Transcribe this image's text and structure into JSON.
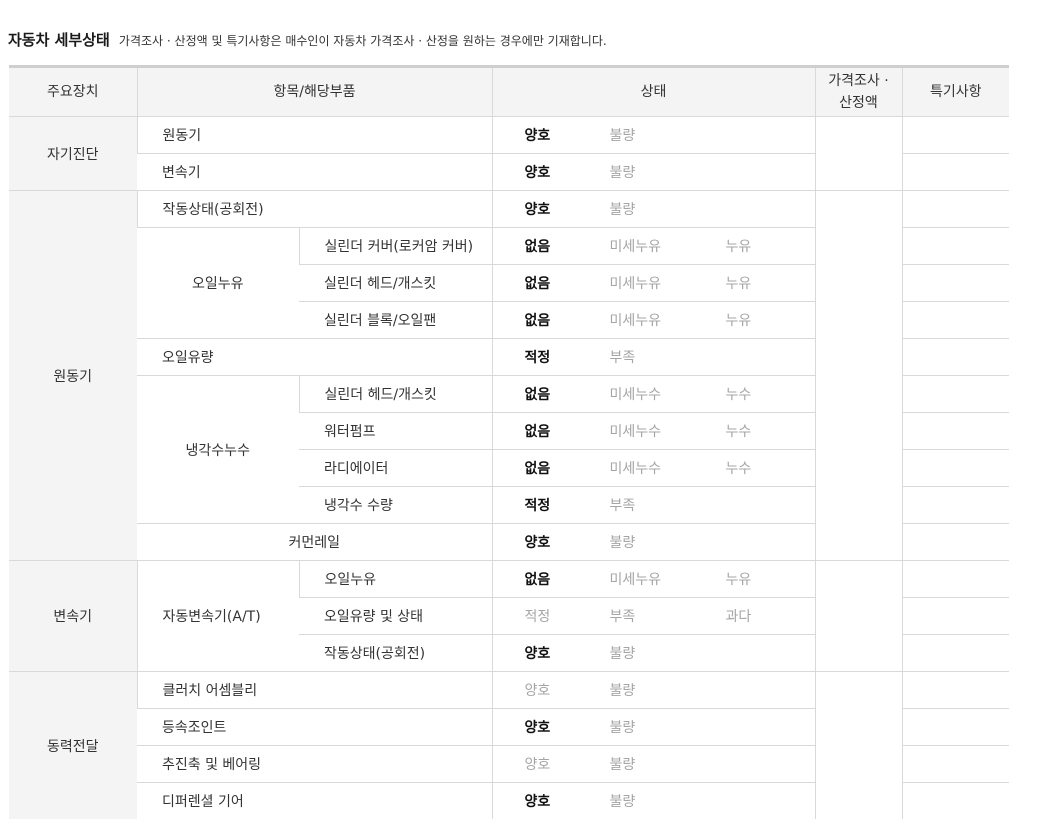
{
  "heading": {
    "title": "자동차 세부상태",
    "description": "가격조사 · 산정액 및 특기사항은 매수인이 자동차 가격조사 · 산정을 원하는 경우에만 기재합니다."
  },
  "columns": {
    "main_device": "주요장치",
    "item": "항목/해당부품",
    "status": "상태",
    "price_line1": "가격조사 ·",
    "price_line2": "산정액",
    "special": "특기사항"
  },
  "sections": {
    "self_diagnosis": "자기진단",
    "engine": "원동기",
    "transmission": "변속기",
    "power_transfer": "동력전달"
  },
  "groups": {
    "oil_leak": "오일누유",
    "coolant_leak": "냉각수누수",
    "auto_transmission": "자동변속기(A/T)"
  },
  "items": {
    "r1": "원동기",
    "r2": "변속기",
    "r3": "작동상태(공회전)",
    "r4": "실린더 커버(로커암 커버)",
    "r5": "실린더 헤드/개스킷",
    "r6": "실린더 블록/오일팬",
    "r7": "오일유량",
    "r8": "실린더 헤드/개스킷",
    "r9": "워터펌프",
    "r10": "라디에이터",
    "r11": "냉각수 수량",
    "r12": "커먼레일",
    "r13": "오일누유",
    "r14": "오일유량 및 상태",
    "r15": "작동상태(공회전)",
    "r16": "클러치 어셈블리",
    "r17": "등속조인트",
    "r18": "추진축 및 베어링",
    "r19": "디퍼렌셜 기어"
  },
  "options": {
    "r1": [
      "양호",
      "불량"
    ],
    "r2": [
      "양호",
      "불량"
    ],
    "r3": [
      "양호",
      "불량"
    ],
    "r4": [
      "없음",
      "미세누유",
      "누유"
    ],
    "r5": [
      "없음",
      "미세누유",
      "누유"
    ],
    "r6": [
      "없음",
      "미세누유",
      "누유"
    ],
    "r7": [
      "적정",
      "부족"
    ],
    "r8": [
      "없음",
      "미세누수",
      "누수"
    ],
    "r9": [
      "없음",
      "미세누수",
      "누수"
    ],
    "r10": [
      "없음",
      "미세누수",
      "누수"
    ],
    "r11": [
      "적정",
      "부족"
    ],
    "r12": [
      "양호",
      "불량"
    ],
    "r13": [
      "없음",
      "미세누유",
      "누유"
    ],
    "r14": [
      "적정",
      "부족",
      "과다"
    ],
    "r15": [
      "양호",
      "불량"
    ],
    "r16": [
      "양호",
      "불량"
    ],
    "r17": [
      "양호",
      "불량"
    ],
    "r18": [
      "양호",
      "불량"
    ],
    "r19": [
      "양호",
      "불량"
    ]
  },
  "selected": {
    "r1": "양호",
    "r2": "양호",
    "r3": "양호",
    "r4": "없음",
    "r5": "없음",
    "r6": "없음",
    "r7": "적정",
    "r8": "없음",
    "r9": "없음",
    "r10": "없음",
    "r11": "적정",
    "r12": "양호",
    "r13": "없음",
    "r14": "",
    "r15": "양호",
    "r16": "",
    "r17": "양호",
    "r18": "",
    "r19": "양호"
  }
}
